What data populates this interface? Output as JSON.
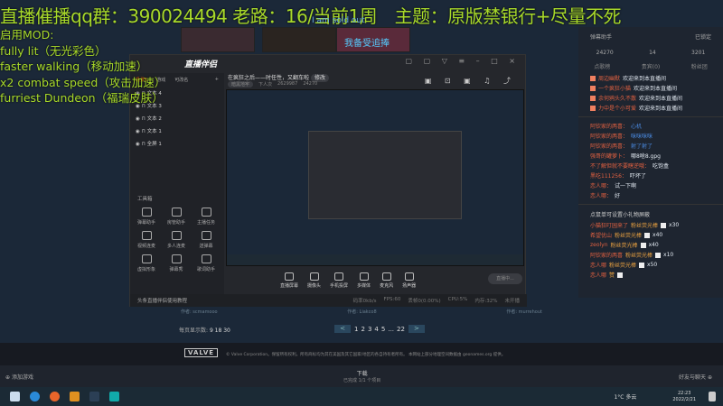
{
  "overlay": {
    "title": "直播催播qq群：390024494 老路：16/当前1周　主题：原版禁银行+尽量不死",
    "mods": [
      "启用MOD:",
      "fully lit（无光彩色）",
      "faster walking（移动加速）",
      "x2 combat speed（攻击加速）",
      "furriest Dundeon（福瑞皮肤）"
    ],
    "song": "I am sold out",
    "banner": "我备受追捧"
  },
  "chat": {
    "title": "弹幕助手",
    "lock": "已锁定",
    "stats": [
      "24270",
      "14",
      "3201"
    ],
    "tabs": [
      "点歌榜",
      "贵宾(0)",
      "粉丝团"
    ],
    "welcome": [
      {
        "name": "周边幽默",
        "text": "欢迎来到本直播间"
      },
      {
        "name": "一个疯狂小猫",
        "text": "欢迎来到本直播间"
      },
      {
        "name": "余何鸦头久不散",
        "text": "欢迎来到本直播间"
      },
      {
        "name": "力中是个小可爱",
        "text": "欢迎来到本直播间"
      }
    ],
    "messages": [
      {
        "name": "阿钦家的两喜：",
        "text": "心机"
      },
      {
        "name": "阿钦家的两喜：",
        "text": "咪咪咪咪"
      },
      {
        "name": "阿钦家的两喜：",
        "text": "射了射了"
      },
      {
        "name": "强哥的罐萝卜：",
        "text": "哪8啥8.gpg"
      },
      {
        "name": "不了解但就不要瞎逆哦：",
        "text": "吃饱盒"
      },
      {
        "name": "黑吃111256：",
        "text": "吓坏了"
      },
      {
        "name": "恋人哪：",
        "text": "试一下啊"
      },
      {
        "name": "恋人哪：",
        "text": "好"
      }
    ],
    "gift_title": "点鼠单可设置小礼物屏蔽",
    "gifts": [
      {
        "name": "小猫狂叮园来了",
        "gift": "粉丝荧光棒",
        "count": "x30"
      },
      {
        "name": "希望优山",
        "gift": "粉丝荧光棒",
        "count": "x40"
      },
      {
        "name": "zeolyn",
        "gift": "粉丝荧光棒",
        "count": "x40"
      },
      {
        "name": "阿钦家的两喜",
        "gift": "粉丝荧光棒",
        "count": "x10"
      },
      {
        "name": "恋人哪",
        "gift": "粉丝荧光棒",
        "count": "x50"
      },
      {
        "name": "恋人哪",
        "gift": "赞",
        "count": ""
      }
    ]
  },
  "app": {
    "logo": "直播伴侣",
    "tabs": [
      "场景1",
      "游戏",
      "可改名"
    ],
    "layers": [
      "文本 4",
      "文本 3",
      "文本 2",
      "文本 1",
      "全屏 1"
    ],
    "title": "在疯狂之后——时任性，又翻车啦",
    "edit": "修改",
    "category": "暗黑地牢",
    "viewers_label": "下人次",
    "viewers": "2629987",
    "likes": "24270",
    "tools_title": "工具箱",
    "tools": [
      "弹幕助手",
      "房管助手",
      "主播任务",
      "视频连麦",
      "多人连麦",
      "送弹幕",
      "虚拟形象",
      "弹幕秀",
      "歌词助手"
    ],
    "toolbar": [
      "直播屏幕",
      "摄像头",
      "手机投屏",
      "多媒体",
      "麦克风",
      "扬声器"
    ],
    "live_button": "直播中...",
    "tutorial": "头条直播伴侣使用教程",
    "status": [
      "码率0kb/s",
      "FPS:60",
      "丢帧0(0.00%)",
      "CPU:5%",
      "内存:32%",
      "未开播"
    ]
  },
  "steam": {
    "authors": [
      "作者: scmamooo",
      "作者: Liakco8",
      "作者: murrehout"
    ],
    "per_page_label": "每页显示数:",
    "per_page": "9 18 30",
    "pages": [
      "1",
      "2",
      "3",
      "4",
      "5",
      "...",
      "22"
    ],
    "prev": "<",
    "next": ">",
    "valve": "VALVE",
    "copyright": "© Valve Corporation。保留所有权利。所有商标均为其在美国及其它国家/地区的各自持有者所有。 本网站上部分地理空间数据由 geonames.org 提供。",
    "add_game": "添加游戏",
    "downloads": "下载",
    "downloads_sub": "已完成 1/1 个项目",
    "friends": "好友与聊天"
  },
  "taskbar": {
    "weather": "1°C 多云",
    "time": "22:23",
    "date": "2022/2/21"
  }
}
